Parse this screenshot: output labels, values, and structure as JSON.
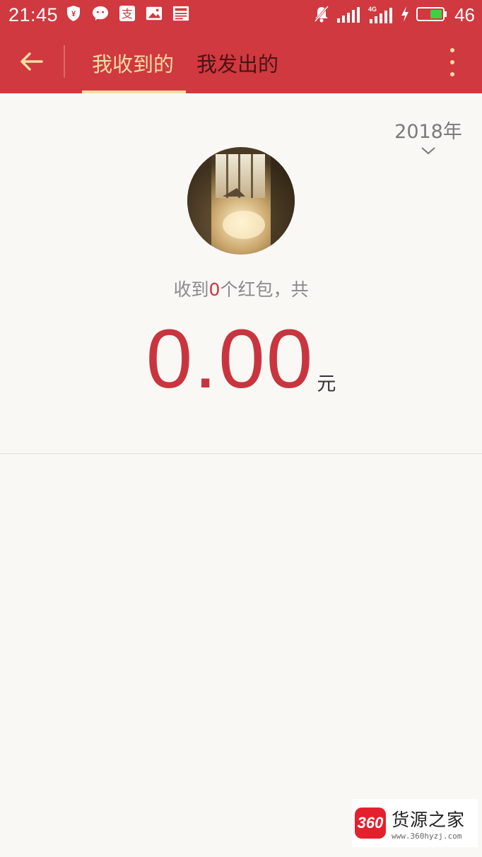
{
  "status_bar": {
    "time": "21:45",
    "battery": "46",
    "network": "4G",
    "icons_left": [
      "shield-yen-icon",
      "wechat-icon",
      "alipay-icon",
      "gallery-icon",
      "news-icon"
    ],
    "icons_right": [
      "mute-icon",
      "signal-icon",
      "signal-4g-icon",
      "charging-icon",
      "battery-icon"
    ]
  },
  "toolbar": {
    "tabs": [
      {
        "label": "我收到的",
        "active": true
      },
      {
        "label": "我发出的",
        "active": false
      }
    ],
    "accent_color": "#d0393f",
    "active_tab_color": "#f6dca4"
  },
  "year_filter": {
    "label": "2018年"
  },
  "summary": {
    "prefix": "收到",
    "count": "0",
    "suffix": "个红包，共"
  },
  "amount": {
    "value": "0.00",
    "unit": "元"
  },
  "watermark": {
    "badge": "360",
    "title": "货源之家",
    "url": "www.360hyzj.com"
  }
}
